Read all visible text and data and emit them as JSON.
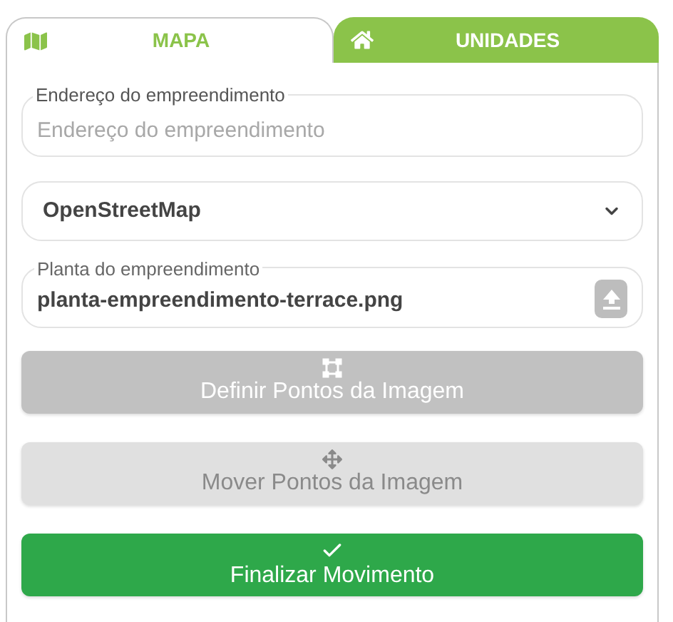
{
  "tabs": [
    {
      "label": "MAPA",
      "kind": "map",
      "selected": true
    },
    {
      "label": "UNIDADES",
      "kind": "home",
      "selected": false
    }
  ],
  "address": {
    "label": "Endereço do empreendimento",
    "placeholder": "Endereço do empreendimento"
  },
  "map_source": {
    "value": "OpenStreetMap"
  },
  "floor_plan": {
    "label": "Planta do empreendimento",
    "value": "planta-empreendimento-terrace.png"
  },
  "buttons": [
    {
      "label": "Definir Pontos da Imagem",
      "kind": "corners",
      "disabled": false
    },
    {
      "label": "Mover Pontos da Imagem",
      "kind": "move",
      "disabled": true
    },
    {
      "label": "Finalizar Movimento",
      "kind": "check",
      "disabled": false
    }
  ]
}
